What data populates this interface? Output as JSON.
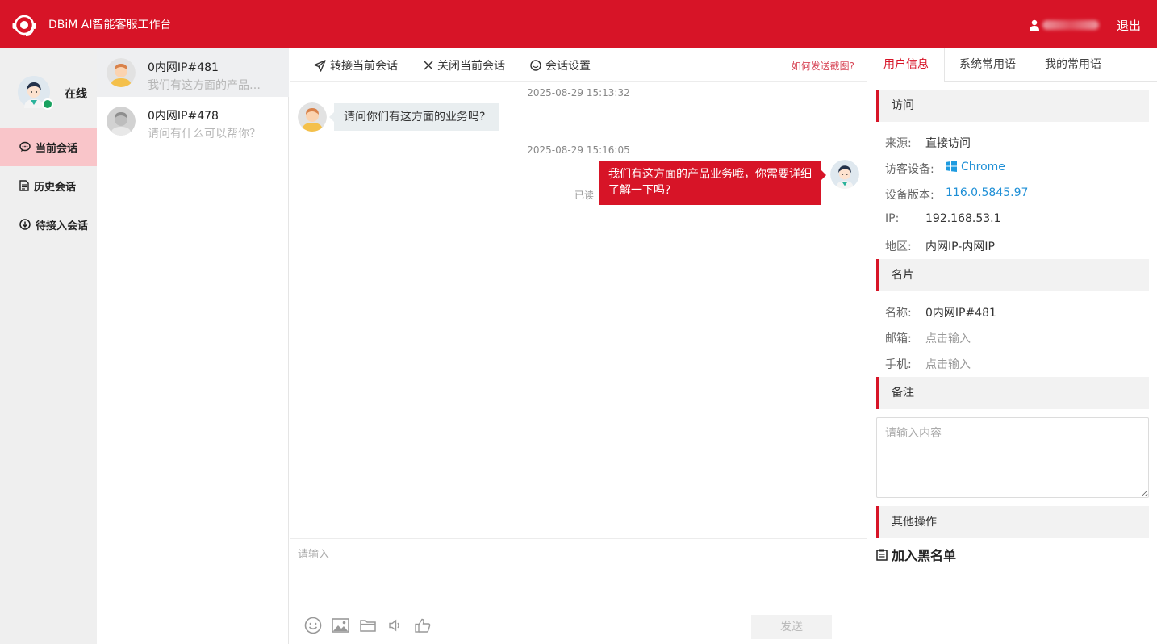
{
  "header": {
    "title": "DBiM AI智能客服工作台",
    "logout_label": "退出",
    "brand_color": "#d71427"
  },
  "leftnav": {
    "status": "在线",
    "items": [
      {
        "label": "当前会话",
        "icon": "chat-bubble-icon",
        "active": true
      },
      {
        "label": "历史会话",
        "icon": "document-icon",
        "active": false
      },
      {
        "label": "待接入会话",
        "icon": "download-circle-icon",
        "active": false
      }
    ]
  },
  "conversations": [
    {
      "name": "0内网IP#481",
      "preview": "我们有这方面的产品业务哦，你需要详细了解一下吗？",
      "active": true
    },
    {
      "name": "0内网IP#478",
      "preview": "请问有什么可以帮你？",
      "active": false
    }
  ],
  "chat": {
    "toolbar": {
      "transfer_label": "转接当前会话",
      "close_label": "关闭当前会话",
      "settings_label": "会话设置",
      "howto_label": "如何发送截图?"
    },
    "messages": [
      {
        "timestamp": "2025-08-29 15:13:32",
        "direction": "in",
        "text": "请问你们有这方面的业务吗?"
      },
      {
        "timestamp": "2025-08-29 15:16:05",
        "direction": "out",
        "text": "我们有这方面的产品业务哦，你需要详细了解一下吗?",
        "read_status": "已读"
      }
    ],
    "composer": {
      "placeholder": "请输入",
      "send_label": "发送",
      "tools": [
        "emoji-icon",
        "image-icon",
        "folder-icon",
        "voice-icon",
        "thumbs-up-icon"
      ]
    }
  },
  "right_panel": {
    "tabs": [
      {
        "label": "用户信息",
        "active": true
      },
      {
        "label": "系统常用语",
        "active": false
      },
      {
        "label": "我的常用语",
        "active": false
      }
    ],
    "visit": {
      "header": "访问",
      "source_label": "来源:",
      "source_value": "直接访问",
      "device_label": "访客设备:",
      "device_value": "Chrome",
      "version_label": "设备版本:",
      "version_value": "116.0.5845.97",
      "ip_label": "IP:",
      "ip_value": "192.168.53.1",
      "region_label": "地区:",
      "region_value": "内网IP-内网IP"
    },
    "card": {
      "header": "名片",
      "name_label": "名称:",
      "name_value": "0内网IP#481",
      "email_label": "邮箱:",
      "email_value": "点击输入",
      "phone_label": "手机:",
      "phone_value": "点击输入"
    },
    "remark": {
      "header": "备注",
      "placeholder": "请输入内容"
    },
    "other": {
      "header": "其他操作",
      "blacklist_label": "加入黑名单"
    }
  }
}
